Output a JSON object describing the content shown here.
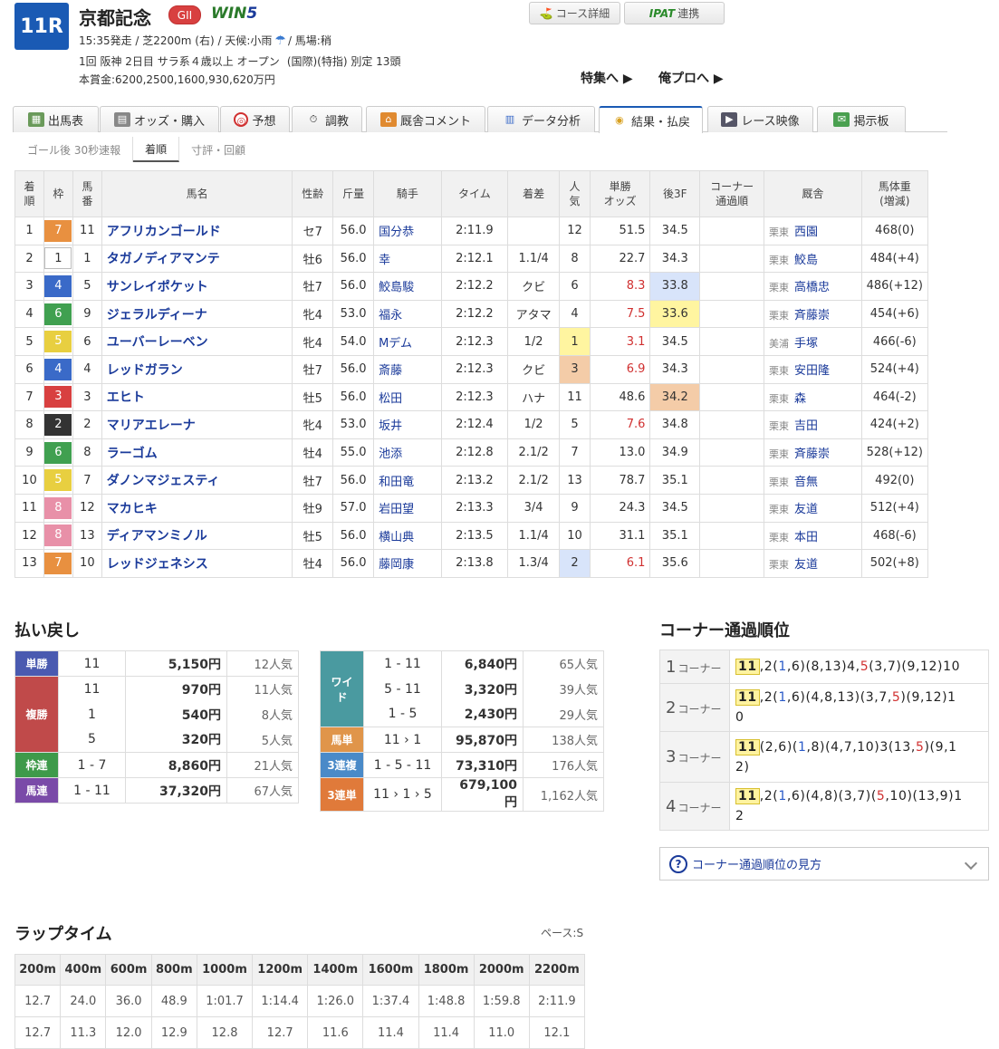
{
  "race": {
    "num": "11R",
    "name": "京都記念",
    "grade": "GII",
    "win5_a": "WIN",
    "win5_b": "5",
    "data1_pre": "15:35発走 / 芝2200m (右) / 天候:小雨",
    "data1_post": "/ 馬場:稍",
    "data2_a": "1回 阪神 2日目 サラ系４歳以上 オープン",
    "data2_b": "(国際)(特指) 別定 13頭",
    "prize": "本賞金:6200,2500,1600,930,620万円"
  },
  "buttons": {
    "course": "コース詳細",
    "ipat": "IPAT",
    "ipat_suffix": "連携",
    "feature": "特集へ ▶",
    "mypro": "俺プロへ ▶"
  },
  "tabs": [
    "出馬表",
    "オッズ・購入",
    "予想",
    "調教",
    "厩舎コメント",
    "データ分析",
    "結果・払戻",
    "レース映像",
    "掲示板"
  ],
  "subtabs": [
    "ゴール後 30秒速報",
    "着順",
    "寸評・回顧"
  ],
  "result_headers": [
    "着順",
    "枠",
    "馬番",
    "馬名",
    "性齢",
    "斤量",
    "騎手",
    "タイム",
    "着差",
    "人気",
    "単勝オッズ",
    "後3F",
    "コーナー通過順",
    "厩舎",
    "馬体重(増減)"
  ],
  "results": [
    {
      "rank": "1",
      "waku": "7",
      "num": "11",
      "name": "アフリカンゴールド",
      "sa": "セ7",
      "w": "56.0",
      "j": "国分恭",
      "t": "2:11.9",
      "d": "",
      "pop": "12",
      "odds": "51.5",
      "f3": "34.5",
      "tr": "栗東",
      "st": "西園",
      "bw": "468(0)"
    },
    {
      "rank": "2",
      "waku": "1",
      "num": "1",
      "name": "タガノディアマンテ",
      "sa": "牡6",
      "w": "56.0",
      "j": "幸",
      "t": "2:12.1",
      "d": "1.1/4",
      "pop": "8",
      "odds": "22.7",
      "f3": "34.3",
      "tr": "栗東",
      "st": "鮫島",
      "bw": "484(+4)"
    },
    {
      "rank": "3",
      "waku": "4",
      "num": "5",
      "name": "サンレイポケット",
      "sa": "牡7",
      "w": "56.0",
      "j": "鮫島駿",
      "t": "2:12.2",
      "d": "クビ",
      "pop": "6",
      "odds": "8.3",
      "f3": "33.8",
      "tr": "栗東",
      "st": "高橋忠",
      "bw": "486(+12)"
    },
    {
      "rank": "4",
      "waku": "6",
      "num": "9",
      "name": "ジェラルディーナ",
      "sa": "牝4",
      "w": "53.0",
      "j": "福永",
      "t": "2:12.2",
      "d": "アタマ",
      "pop": "4",
      "odds": "7.5",
      "f3": "33.6",
      "tr": "栗東",
      "st": "斉藤崇",
      "bw": "454(+6)"
    },
    {
      "rank": "5",
      "waku": "5",
      "num": "6",
      "name": "ユーバーレーベン",
      "sa": "牝4",
      "w": "54.0",
      "j": "Mデム",
      "t": "2:12.3",
      "d": "1/2",
      "pop": "1",
      "odds": "3.1",
      "f3": "34.5",
      "tr": "美浦",
      "st": "手塚",
      "bw": "466(-6)"
    },
    {
      "rank": "6",
      "waku": "4",
      "num": "4",
      "name": "レッドガラン",
      "sa": "牡7",
      "w": "56.0",
      "j": "斎藤",
      "t": "2:12.3",
      "d": "クビ",
      "pop": "3",
      "odds": "6.9",
      "f3": "34.3",
      "tr": "栗東",
      "st": "安田隆",
      "bw": "524(+4)"
    },
    {
      "rank": "7",
      "waku": "3",
      "num": "3",
      "name": "エヒト",
      "sa": "牡5",
      "w": "56.0",
      "j": "松田",
      "t": "2:12.3",
      "d": "ハナ",
      "pop": "11",
      "odds": "48.6",
      "f3": "34.2",
      "tr": "栗東",
      "st": "森",
      "bw": "464(-2)"
    },
    {
      "rank": "8",
      "waku": "2",
      "num": "2",
      "name": "マリアエレーナ",
      "sa": "牝4",
      "w": "53.0",
      "j": "坂井",
      "t": "2:12.4",
      "d": "1/2",
      "pop": "5",
      "odds": "7.6",
      "f3": "34.8",
      "tr": "栗東",
      "st": "吉田",
      "bw": "424(+2)"
    },
    {
      "rank": "9",
      "waku": "6",
      "num": "8",
      "name": "ラーゴム",
      "sa": "牡4",
      "w": "55.0",
      "j": "池添",
      "t": "2:12.8",
      "d": "2.1/2",
      "pop": "7",
      "odds": "13.0",
      "f3": "34.9",
      "tr": "栗東",
      "st": "斉藤崇",
      "bw": "528(+12)"
    },
    {
      "rank": "10",
      "waku": "5",
      "num": "7",
      "name": "ダノンマジェスティ",
      "sa": "牡7",
      "w": "56.0",
      "j": "和田竜",
      "t": "2:13.2",
      "d": "2.1/2",
      "pop": "13",
      "odds": "78.7",
      "f3": "35.1",
      "tr": "栗東",
      "st": "音無",
      "bw": "492(0)"
    },
    {
      "rank": "11",
      "waku": "8",
      "num": "12",
      "name": "マカヒキ",
      "sa": "牡9",
      "w": "57.0",
      "j": "岩田望",
      "t": "2:13.3",
      "d": "3/4",
      "pop": "9",
      "odds": "24.3",
      "f3": "34.5",
      "tr": "栗東",
      "st": "友道",
      "bw": "512(+4)"
    },
    {
      "rank": "12",
      "waku": "8",
      "num": "13",
      "name": "ディアマンミノル",
      "sa": "牡5",
      "w": "56.0",
      "j": "横山典",
      "t": "2:13.5",
      "d": "1.1/4",
      "pop": "10",
      "odds": "31.1",
      "f3": "35.1",
      "tr": "栗東",
      "st": "本田",
      "bw": "468(-6)"
    },
    {
      "rank": "13",
      "waku": "7",
      "num": "10",
      "name": "レッドジェネシス",
      "sa": "牡4",
      "w": "56.0",
      "j": "藤岡康",
      "t": "2:13.8",
      "d": "1.3/4",
      "pop": "2",
      "odds": "6.1",
      "f3": "35.6",
      "tr": "栗東",
      "st": "友道",
      "bw": "502(+8)"
    }
  ],
  "payout_title": "払い戻し",
  "payout_left": {
    "tan": {
      "label": "単勝",
      "num": "11",
      "amt": "5,150円",
      "pop": "12人気"
    },
    "fuku": {
      "label": "複勝",
      "rows": [
        {
          "num": "11",
          "amt": "970円",
          "pop": "11人気"
        },
        {
          "num": "1",
          "amt": "540円",
          "pop": "8人気"
        },
        {
          "num": "5",
          "amt": "320円",
          "pop": "5人気"
        }
      ]
    },
    "waku": {
      "label": "枠連",
      "num": "1 - 7",
      "amt": "8,860円",
      "pop": "21人気"
    },
    "uren": {
      "label": "馬連",
      "num": "1 - 11",
      "amt": "37,320円",
      "pop": "67人気"
    }
  },
  "payout_right": {
    "wide": {
      "label": "ワイド",
      "rows": [
        {
          "num": "1 - 11",
          "amt": "6,840円",
          "pop": "65人気"
        },
        {
          "num": "5 - 11",
          "amt": "3,320円",
          "pop": "39人気"
        },
        {
          "num": "1 - 5",
          "amt": "2,430円",
          "pop": "29人気"
        }
      ]
    },
    "utan": {
      "label": "馬単",
      "num": "11 › 1",
      "amt": "95,870円",
      "pop": "138人気"
    },
    "sanfuku": {
      "label": "3連複",
      "num": "1 - 5 - 11",
      "amt": "73,310円",
      "pop": "176人気"
    },
    "santan": {
      "label": "3連単",
      "num": "11 › 1 › 5",
      "amt": "679,100円",
      "pop": "1,162人気"
    }
  },
  "corner_title": "コーナー通過順位",
  "corner_suffix": "コーナー",
  "corners": [
    "1",
    "2",
    "3",
    "4"
  ],
  "howto": "コーナー通過順位の見方",
  "lap_title": "ラップタイム",
  "pace": "ペース:S",
  "lap_headers": [
    "200m",
    "400m",
    "600m",
    "800m",
    "1000m",
    "1200m",
    "1400m",
    "1600m",
    "1800m",
    "2000m",
    "2200m"
  ],
  "lap_cum": [
    "12.7",
    "24.0",
    "36.0",
    "48.9",
    "1:01.7",
    "1:14.4",
    "1:26.0",
    "1:37.4",
    "1:48.8",
    "1:59.8",
    "2:11.9"
  ],
  "lap_split": [
    "12.7",
    "11.3",
    "12.0",
    "12.9",
    "12.8",
    "12.7",
    "11.6",
    "11.4",
    "11.4",
    "11.0",
    "12.1"
  ],
  "colors": {
    "race_num_bg": "#1a5ab4",
    "link": "#1a3a9a",
    "pop1": "#fff5a0",
    "pop2": "#d8e4fa",
    "pop3": "#f4cca8"
  },
  "icons": [
    "umbrella-icon",
    "course-icon",
    "ipat-icon",
    "question-icon",
    "chevron-down-icon"
  ]
}
